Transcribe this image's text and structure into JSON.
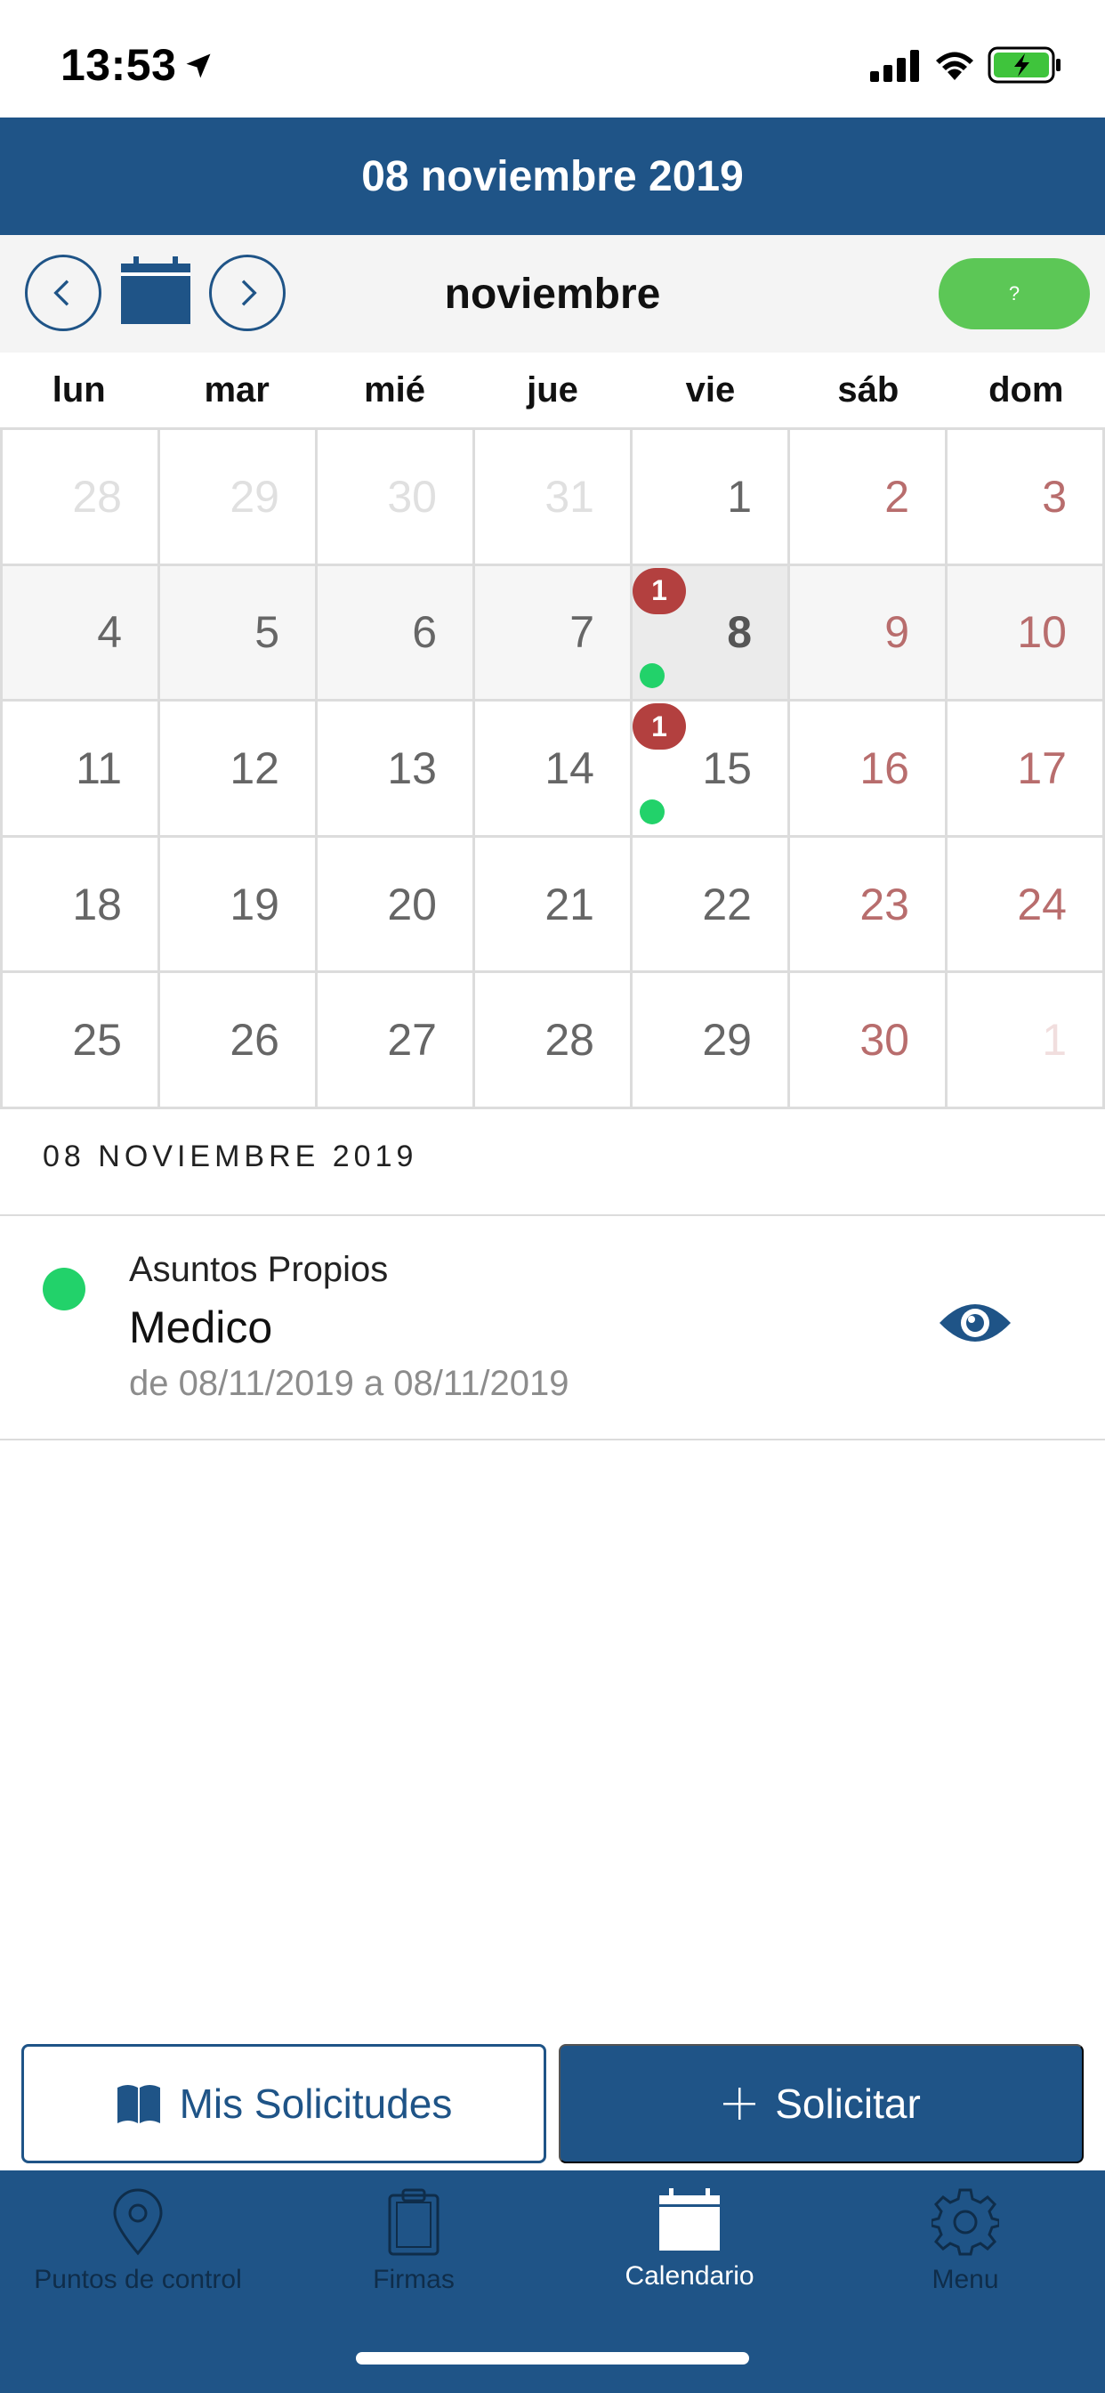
{
  "status_bar": {
    "time": "13:53"
  },
  "header": {
    "title": "08 noviembre 2019"
  },
  "month_nav": {
    "month": "noviembre",
    "help_label": "?"
  },
  "weekdays": [
    "lun",
    "mar",
    "mié",
    "jue",
    "vie",
    "sáb",
    "dom"
  ],
  "calendar": {
    "weeks": [
      [
        {
          "day": "28",
          "other": true
        },
        {
          "day": "29",
          "other": true
        },
        {
          "day": "30",
          "other": true
        },
        {
          "day": "31",
          "other": true
        },
        {
          "day": "1"
        },
        {
          "day": "2",
          "weekend": true
        },
        {
          "day": "3",
          "weekend": true
        }
      ],
      [
        {
          "day": "4"
        },
        {
          "day": "5"
        },
        {
          "day": "6"
        },
        {
          "day": "7"
        },
        {
          "day": "8",
          "selected": true,
          "badge": "1",
          "dot": true
        },
        {
          "day": "9",
          "weekend": true
        },
        {
          "day": "10",
          "weekend": true
        }
      ],
      [
        {
          "day": "11"
        },
        {
          "day": "12"
        },
        {
          "day": "13"
        },
        {
          "day": "14"
        },
        {
          "day": "15",
          "badge": "1",
          "dot": true
        },
        {
          "day": "16",
          "weekend": true
        },
        {
          "day": "17",
          "weekend": true
        }
      ],
      [
        {
          "day": "18"
        },
        {
          "day": "19"
        },
        {
          "day": "20"
        },
        {
          "day": "21"
        },
        {
          "day": "22"
        },
        {
          "day": "23",
          "weekend": true
        },
        {
          "day": "24",
          "weekend": true
        }
      ],
      [
        {
          "day": "25"
        },
        {
          "day": "26"
        },
        {
          "day": "27"
        },
        {
          "day": "28"
        },
        {
          "day": "29"
        },
        {
          "day": "30",
          "weekend": true
        },
        {
          "day": "1",
          "weekend": true,
          "other": true
        }
      ]
    ],
    "selected_week": 1
  },
  "selected_date_heading": "08 NOVIEMBRE 2019",
  "event": {
    "category": "Asuntos Propios",
    "title": "Medico",
    "range": "de 08/11/2019 a 08/11/2019",
    "status_color": "#22d26a"
  },
  "actions": {
    "requests_label": "Mis Solicitudes",
    "request_label": "Solicitar"
  },
  "tabs": [
    {
      "label": "Puntos de control",
      "icon": "map-pin-icon",
      "active": false
    },
    {
      "label": "Firmas",
      "icon": "clipboard-icon",
      "active": false
    },
    {
      "label": "Calendario",
      "icon": "calendar-icon",
      "active": true
    },
    {
      "label": "Menu",
      "icon": "gear-icon",
      "active": false
    }
  ],
  "colors": {
    "primary": "#1f5487",
    "accent_green": "#5cc756",
    "badge_red": "#b3403f",
    "weekend_red": "#b86d6d"
  }
}
